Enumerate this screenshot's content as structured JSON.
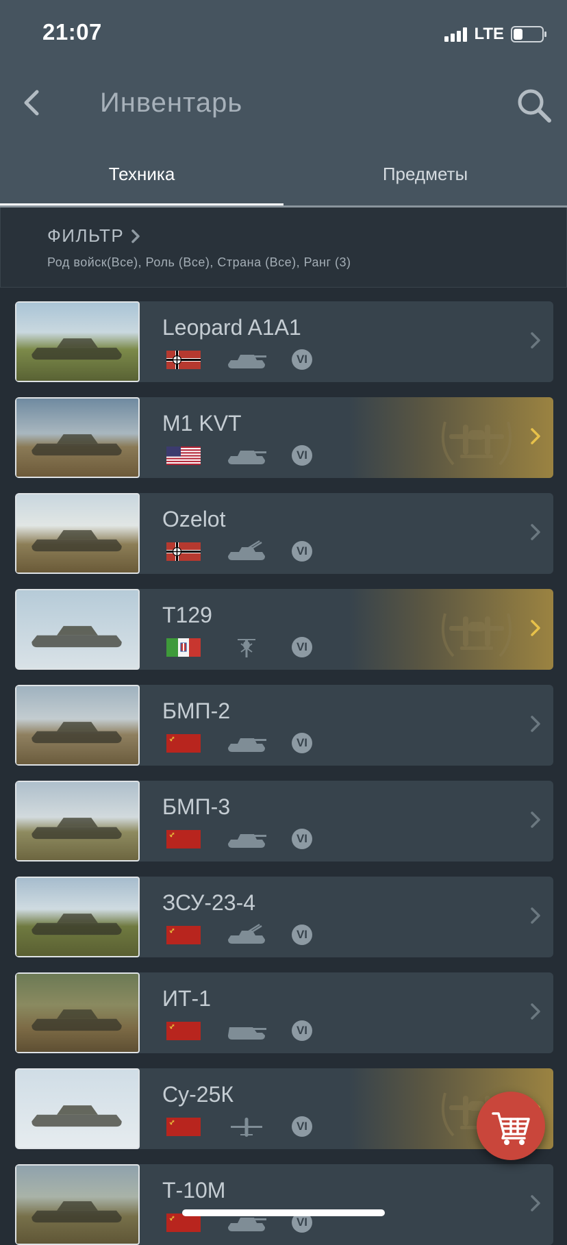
{
  "status_bar": {
    "time": "21:07",
    "network": "LTE"
  },
  "header": {
    "title": "Инвентарь"
  },
  "tabs": [
    {
      "label": "Техника"
    },
    {
      "label": "Предметы"
    }
  ],
  "filter": {
    "title": "ФИЛЬТР",
    "summary": "Род войск(Все), Роль (Все), Страна (Все), Ранг (3)"
  },
  "vehicles": [
    {
      "name": "Leopard A1A1",
      "flag": "germany-flag",
      "type": "tank-icon",
      "rank": "VI",
      "premium": false
    },
    {
      "name": "M1 KVT",
      "flag": "usa-flag",
      "type": "tank-icon",
      "rank": "VI",
      "premium": true
    },
    {
      "name": "Ozelot",
      "flag": "germany-flag",
      "type": "spaa-icon",
      "rank": "VI",
      "premium": false
    },
    {
      "name": "T129",
      "flag": "italy-flag",
      "type": "helicopter-icon",
      "rank": "VI",
      "premium": true
    },
    {
      "name": "БМП-2",
      "flag": "ussr-flag",
      "type": "tank-icon",
      "rank": "VI",
      "premium": false
    },
    {
      "name": "БМП-3",
      "flag": "ussr-flag",
      "type": "tank-icon",
      "rank": "VI",
      "premium": false
    },
    {
      "name": "ЗСУ-23-4",
      "flag": "ussr-flag",
      "type": "spaa-icon",
      "rank": "VI",
      "premium": false
    },
    {
      "name": "ИТ-1",
      "flag": "ussr-flag",
      "type": "tank-destroyer-icon",
      "rank": "VI",
      "premium": false
    },
    {
      "name": "Су-25К",
      "flag": "ussr-flag",
      "type": "aircraft-icon",
      "rank": "VI",
      "premium": true
    },
    {
      "name": "Т-10М",
      "flag": "ussr-flag",
      "type": "tank-icon",
      "rank": "VI",
      "premium": false
    }
  ],
  "colors": {
    "header_bg": "#46545f",
    "list_bg": "#252d35",
    "row_bg": "#37434c",
    "premium_gold": "#9b8341",
    "cart_red": "#c9463b"
  }
}
